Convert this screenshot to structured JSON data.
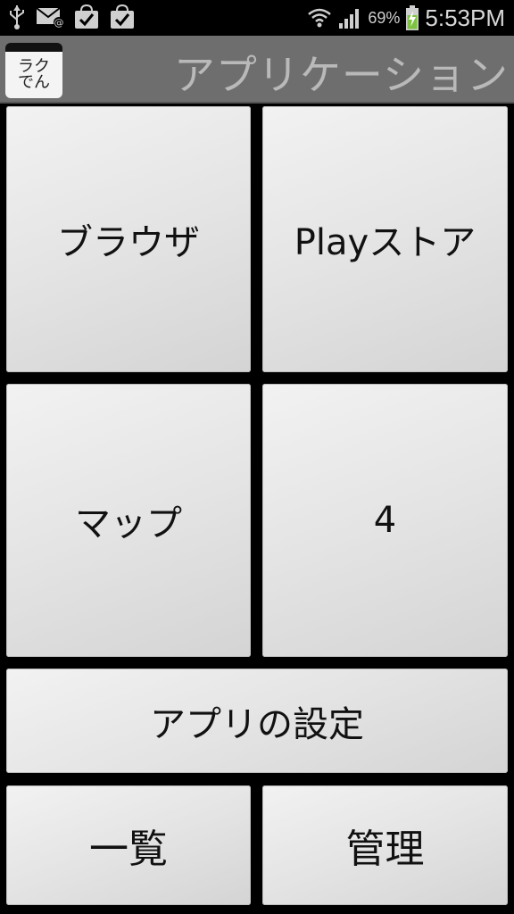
{
  "status_bar": {
    "left_icons": [
      "usb-icon",
      "mail-icon",
      "shopping-bag-check-icon",
      "shopping-bag-check-icon"
    ],
    "battery_percent": "69%",
    "time": "5:53PM"
  },
  "header": {
    "logo_line1": "ラク",
    "logo_line2": "でん",
    "title": "アプリケーション"
  },
  "tiles": {
    "browser": "ブラウザ",
    "play_store": "Playストア",
    "maps": "マップ",
    "four": "4",
    "app_settings": "アプリの設定",
    "list": "一覧",
    "manage": "管理"
  }
}
